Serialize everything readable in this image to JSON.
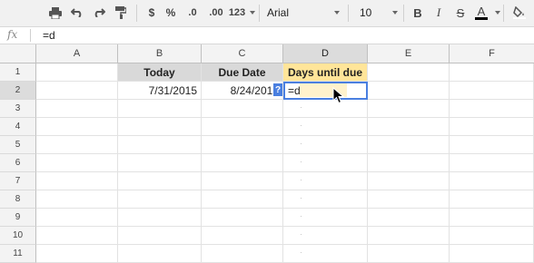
{
  "toolbar": {
    "currency_symbol": "$",
    "percent_symbol": "%",
    "decrease_decimals": ".0",
    "increase_decimals": ".00",
    "number_format": "123",
    "font_family": "Arial",
    "font_size": "10",
    "bold": "B",
    "italic": "I",
    "strikethrough": "S",
    "text_color": "A"
  },
  "formula_bar": {
    "fx_label": "fx",
    "formula": "=d"
  },
  "columns": [
    "A",
    "B",
    "C",
    "D",
    "E",
    "F"
  ],
  "rows": [
    "1",
    "2",
    "3",
    "4",
    "5",
    "6",
    "7",
    "8",
    "9",
    "10",
    "11"
  ],
  "cells": {
    "B1": "Today",
    "C1": "Due Date",
    "D1": "Days until due",
    "B2": "7/31/2015",
    "C2": "8/24/2015",
    "D2": "=d"
  },
  "help_badge": "?",
  "colors": {
    "header_fill": "#d9d9d9",
    "highlight_fill": "#ffe599",
    "selection_border": "#4a7fe0"
  }
}
